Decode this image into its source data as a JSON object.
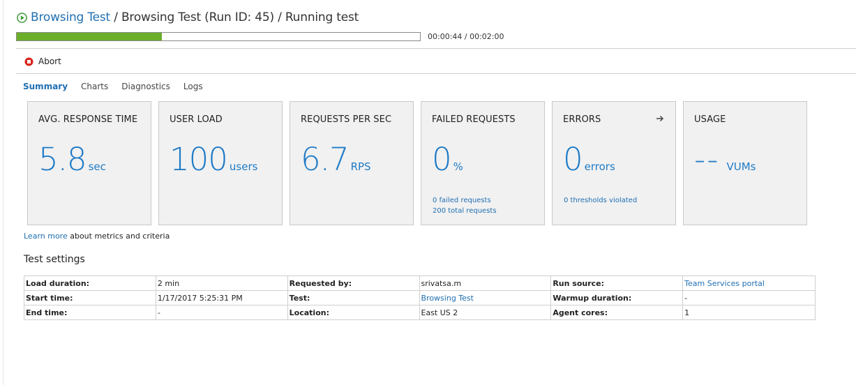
{
  "header": {
    "breadcrumb_link": "Browsing Test",
    "breadcrumb_rest": " / Browsing Test (Run ID: 45) / Running test"
  },
  "progress": {
    "fraction": 0.359,
    "time_text": "00:00:44 / 00:02:00",
    "color": "#6aae2a"
  },
  "toolbar": {
    "abort_label": "Abort"
  },
  "tabs": [
    {
      "label": "Summary",
      "active": true
    },
    {
      "label": "Charts",
      "active": false
    },
    {
      "label": "Diagnostics",
      "active": false
    },
    {
      "label": "Logs",
      "active": false
    }
  ],
  "cards": [
    {
      "title": "AVG. RESPONSE TIME",
      "value": "5.8",
      "unit": "sec"
    },
    {
      "title": "USER LOAD",
      "value": "100",
      "unit": "users"
    },
    {
      "title": "REQUESTS PER SEC",
      "value": "6.7",
      "unit": "RPS"
    },
    {
      "title": "FAILED REQUESTS",
      "value": "0",
      "unit": "%",
      "link1": "0 failed requests",
      "link2": "200 total requests"
    },
    {
      "title": "ERRORS",
      "value": "0",
      "unit": "errors",
      "link1": "0 thresholds violated"
    },
    {
      "title": "USAGE",
      "value": "--",
      "unit": "VUMs"
    }
  ],
  "learn": {
    "link": "Learn more",
    "text": " about metrics and criteria"
  },
  "settings": {
    "title": "Test settings",
    "rows": [
      [
        "Load duration:",
        "2 min",
        "Requested by:",
        "srivatsa.m",
        "Run source:",
        "Team Services portal"
      ],
      [
        "Start time:",
        "1/17/2017 5:25:31 PM",
        "Test:",
        "Browsing Test",
        "Warmup duration:",
        "-"
      ],
      [
        "End time:",
        "-",
        "Location:",
        "East US 2",
        "Agent cores:",
        "1"
      ]
    ]
  },
  "colors": {
    "accent": "#1f7ac6",
    "link": "#1f6fb2",
    "progress": "#6aae2a",
    "abort": "#d9261c",
    "play": "#3a9a3a"
  }
}
